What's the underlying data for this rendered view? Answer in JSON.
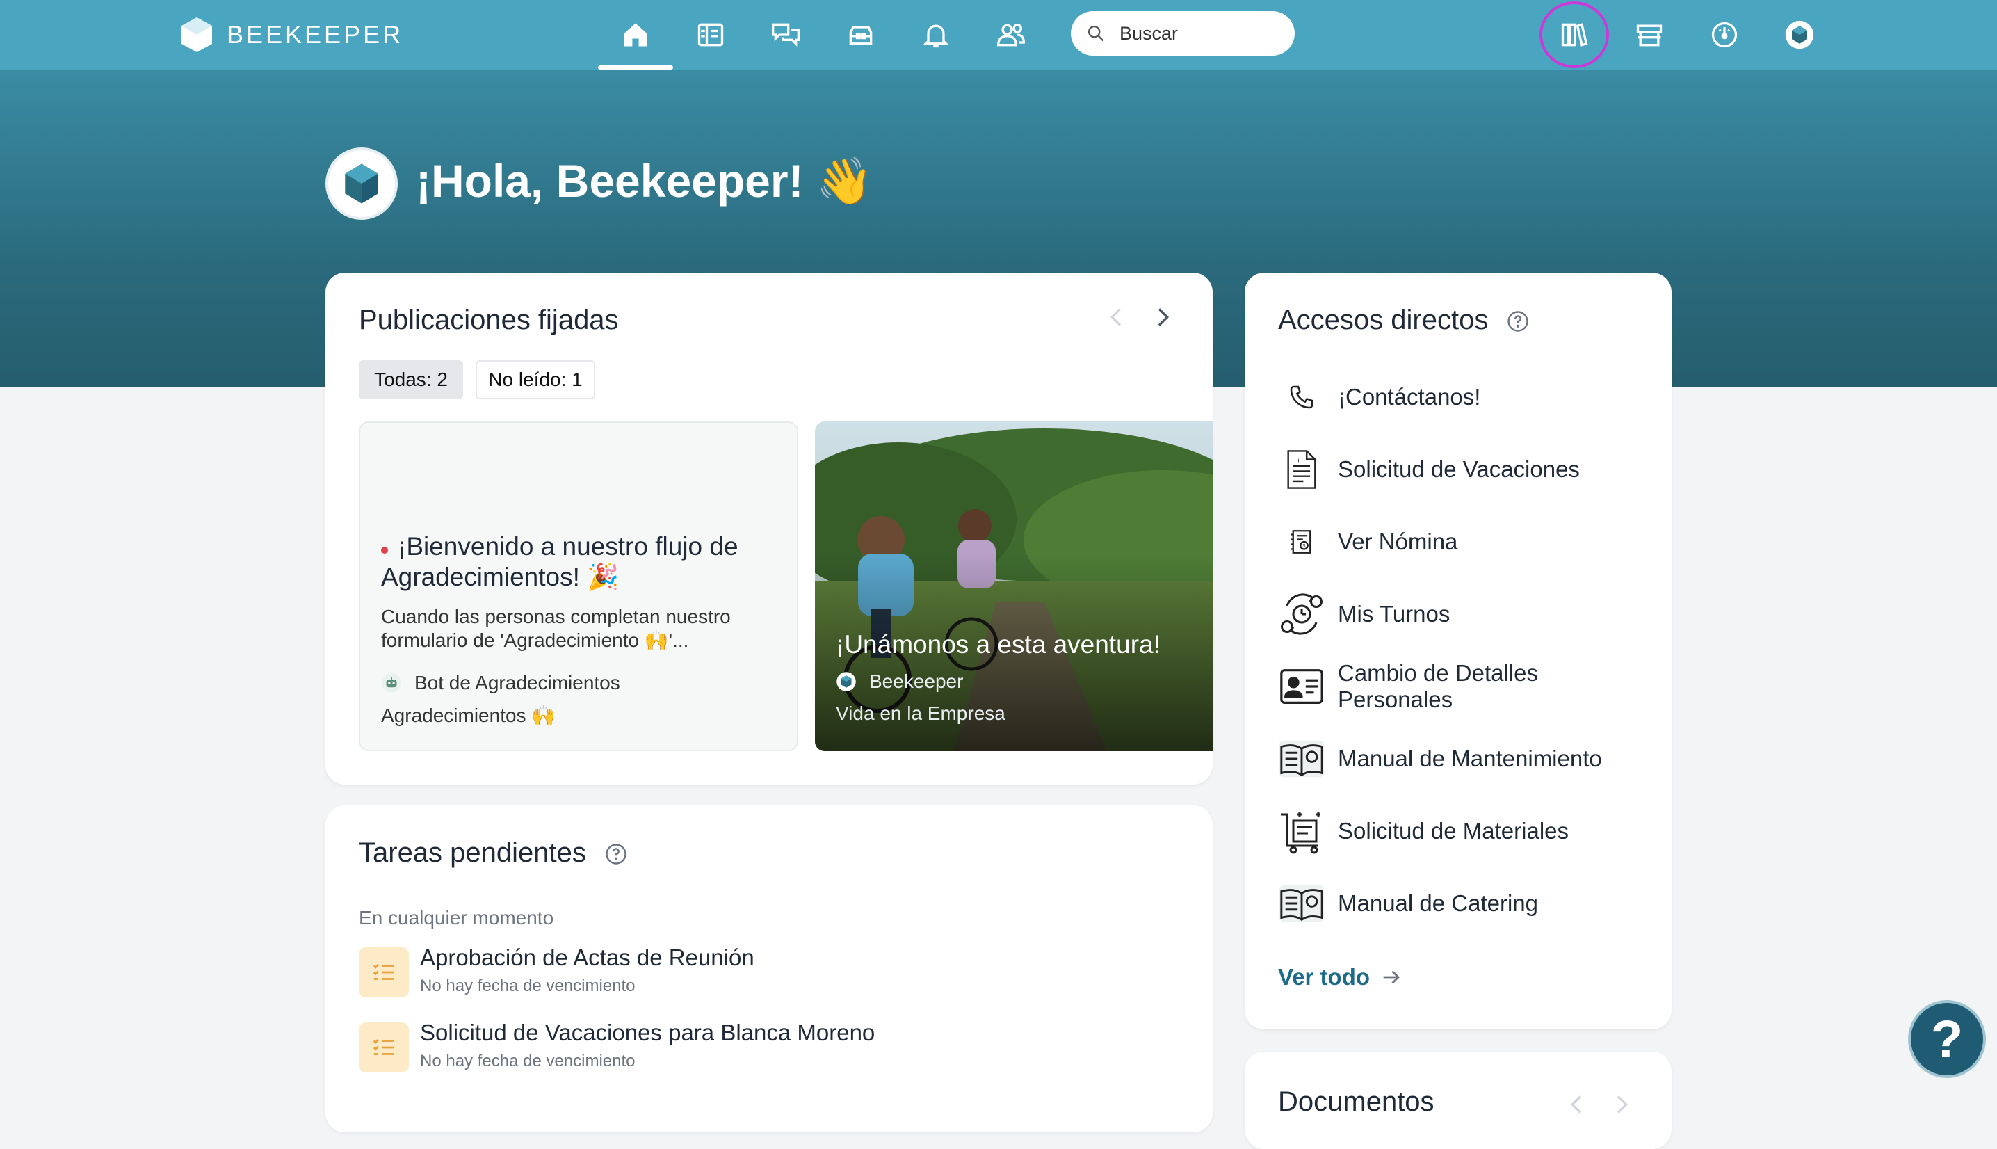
{
  "brand": {
    "name": "BEEKEEPER"
  },
  "nav": {
    "icons": [
      "home-icon",
      "news-icon",
      "chat-icon",
      "toolbox-icon",
      "bell-icon",
      "people-icon"
    ],
    "search_placeholder": "Buscar",
    "right_icons": [
      "library-icon",
      "store-icon",
      "dashboard-icon",
      "profile-avatar"
    ]
  },
  "hero": {
    "greeting": "¡Hola, Beekeeper! 👋"
  },
  "pinned": {
    "title": "Publicaciones fijadas",
    "filters": {
      "all": "Todas: 2",
      "unread": "No leído: 1"
    },
    "posts": [
      {
        "title": "¡Bienvenido a nuestro flujo de Agradecimientos! 🎉",
        "excerpt": "Cuando las personas completan nuestro formulario de 'Agradecimiento 🙌'...",
        "author": "Bot de Agradecimientos",
        "group": "Agradecimientos 🙌",
        "unread": true
      },
      {
        "title": "¡Unámonos a esta aventura!",
        "author": "Beekeeper",
        "group": "Vida en la Empresa"
      }
    ]
  },
  "tasks": {
    "title": "Tareas pendientes",
    "section": "En cualquier momento",
    "items": [
      {
        "name": "Aprobación de Actas de Reunión",
        "due": "No hay fecha de vencimiento"
      },
      {
        "name": "Solicitud de Vacaciones para Blanca Moreno",
        "due": "No hay fecha de vencimiento"
      }
    ]
  },
  "shortcuts": {
    "title": "Accesos directos",
    "items": [
      {
        "label": "¡Contáctanos!",
        "icon": "phone-icon"
      },
      {
        "label": "Solicitud de Vacaciones",
        "icon": "document-icon"
      },
      {
        "label": "Ver Nómina",
        "icon": "payroll-icon"
      },
      {
        "label": "Mis Turnos",
        "icon": "shift-cycle-icon"
      },
      {
        "label": "Cambio de Detalles Personales",
        "icon": "id-card-icon"
      },
      {
        "label": "Manual de Mantenimiento",
        "icon": "manual-book-icon"
      },
      {
        "label": "Solicitud de Materiales",
        "icon": "materials-cart-icon"
      },
      {
        "label": "Manual de Catering",
        "icon": "manual-book-icon"
      }
    ],
    "see_all": "Ver todo"
  },
  "documents": {
    "title": "Documentos"
  },
  "help": {
    "label": "?"
  }
}
